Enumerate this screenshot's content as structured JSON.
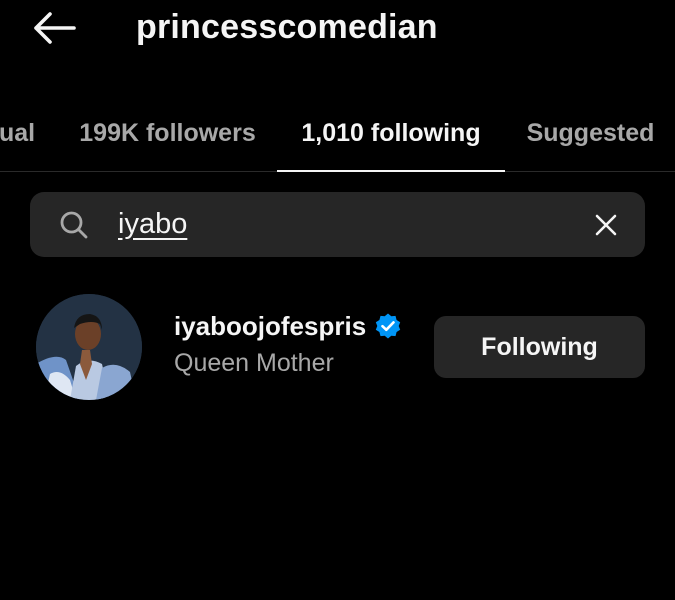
{
  "header": {
    "title": "princesscomedian",
    "back_icon": "arrow-left-icon"
  },
  "tabs": [
    {
      "label": "ual",
      "active": false
    },
    {
      "label": "199K followers",
      "active": false
    },
    {
      "label": "1,010 following",
      "active": true
    },
    {
      "label": "Suggested",
      "active": false
    }
  ],
  "search": {
    "value": "iyabo",
    "placeholder": "",
    "icon": "search-icon",
    "clear_icon": "close-icon"
  },
  "results": [
    {
      "username": "iyaboojofespris",
      "verified": true,
      "subtitle": "Queen Mother",
      "button_label": "Following"
    }
  ],
  "colors": {
    "background": "#000000",
    "surface": "#262626",
    "text_primary": "#f5f5f5",
    "text_secondary": "#a8a8a8",
    "verified": "#0095f6"
  }
}
